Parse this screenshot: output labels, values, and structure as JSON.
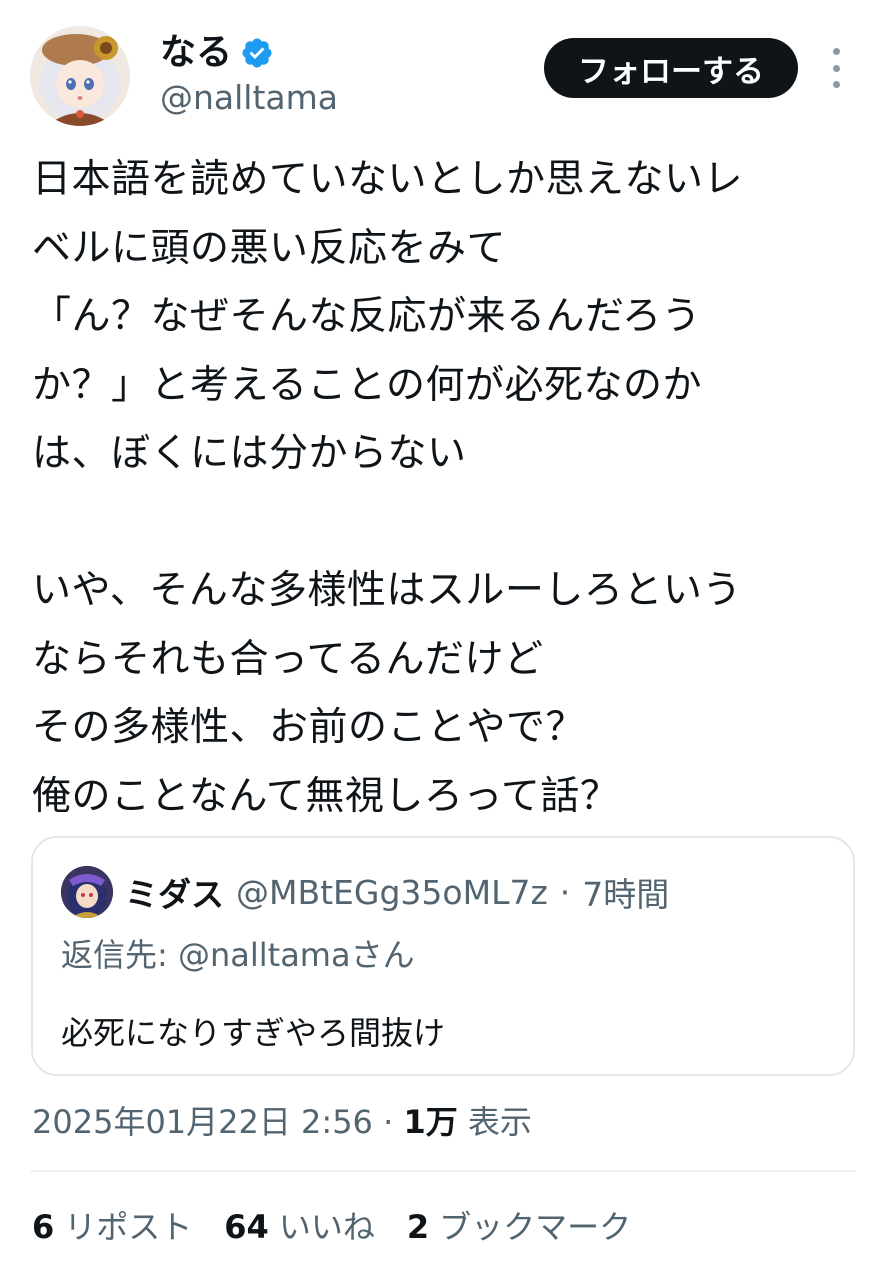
{
  "author": {
    "display_name": "なる",
    "handle": "@nalltama",
    "verified": true
  },
  "follow_button": {
    "label": "フォローする"
  },
  "tweet": {
    "text": "日本語を読めていないとしか思えないレ\nベルに頭の悪い反応をみて\n「ん？なぜそんな反応が来るんだろう\nか？」と考えることの何が必死なのか\nは、ぼくには分からない\n\nいや、そんな多様性はスルーしろという\nならそれも合ってるんだけど\nその多様性、お前のことやで？\n俺のことなんて無視しろって話？"
  },
  "quoted": {
    "name": "ミダス",
    "handle": "@MBtEGg35oML7z",
    "separator": "·",
    "time": "7時間",
    "reply_prefix": "返信先: ",
    "reply_to": "@nalltamaさん",
    "text": "必死になりすぎやろ間抜け"
  },
  "meta": {
    "datetime": "2025年01月22日 2:56",
    "separator": " · ",
    "views_count": "1万",
    "views_label": " 表示"
  },
  "stats": {
    "reposts": {
      "count": "6",
      "label": "リポスト"
    },
    "likes": {
      "count": "64",
      "label": "いいね"
    },
    "bookmarks": {
      "count": "2",
      "label": "ブックマーク"
    }
  },
  "colors": {
    "text": "#0f1419",
    "secondary": "#536471",
    "verified": "#1d9bf0",
    "border": "#e1e8ed",
    "button_bg": "#0f1419"
  }
}
